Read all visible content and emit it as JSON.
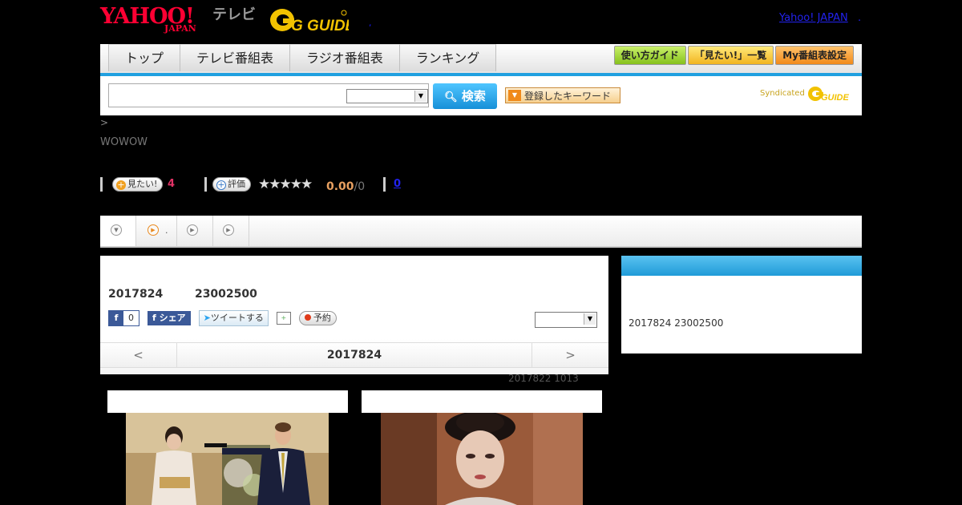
{
  "header": {
    "logo_yahoo": "YAHOO!",
    "logo_japan": "JAPAN",
    "logo_tv": "テレビ",
    "logo_gguide": "G GUIDE",
    "comma": ",",
    "yahoo_link": "Yahoo! JAPAN",
    "yahoo_link_dot": "."
  },
  "nav": {
    "tabs": [
      {
        "label": "トップ"
      },
      {
        "label": "テレビ番組表"
      },
      {
        "label": "ラジオ番組表"
      },
      {
        "label": "ランキング"
      }
    ],
    "right_buttons": [
      {
        "label": "使い方ガイド",
        "color": "#86c11c"
      },
      {
        "label": "「見たい!」一覧",
        "color": "#f2b420"
      },
      {
        "label": "My番組表設定",
        "color": "#f28a1a"
      }
    ]
  },
  "search": {
    "input_value": "",
    "select_value": "",
    "button_label": "検索",
    "keyword_button": "登録したキーワード",
    "syndicated": "Syndicated"
  },
  "breadcrumb": ">",
  "channel": "WOWOW",
  "rating": {
    "want_label": "見たい!",
    "want_count": "4",
    "eval_label": "評価",
    "stars": "★★★★★",
    "star_count": 5,
    "score": "0.00",
    "score_total": "/0",
    "review_count": "0"
  },
  "tabs": [
    {
      "label": ""
    },
    {
      "label": "."
    },
    {
      "label": ""
    },
    {
      "label": ""
    }
  ],
  "main": {
    "air_date": "2017824",
    "air_time": "23002500",
    "fb_like_count": "0",
    "fb_share": "シェア",
    "tweet": "ツイートする",
    "reserve": "予約",
    "select_value": "",
    "prev": "<",
    "current_date": "2017824",
    "next": ">",
    "updated": "2017822  1013"
  },
  "side": {
    "text": "2017824  23002500"
  },
  "colors": {
    "accent_blue": "#20a0e0",
    "want_pink": "#e23366",
    "score_orange": "#e8a060",
    "yahoo_red": "#ff0033"
  }
}
